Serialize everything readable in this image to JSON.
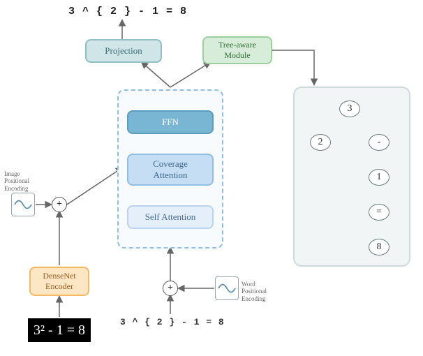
{
  "output_sequence": "3 ^ { 2 } - 1 = 8",
  "input_sequence": "3 ^ { 2 } - 1 = 8",
  "handwritten_input_display": "3² - 1 = 8",
  "blocks": {
    "densenet": "DenseNet\nEncoder",
    "projection": "Projection",
    "treeaware": "Tree-aware\nModule",
    "self_attention": "Self Attention",
    "coverage_attention": "Coverage\nAttention",
    "ffn": "FFN"
  },
  "captions": {
    "image_positional_encoding": "Image\nPositional\nEncoding",
    "word_positional_encoding": "Word\nPositional\nEncoding"
  },
  "tree": {
    "root": "3",
    "left": "2",
    "right": "-",
    "r_down1": "1",
    "r_down2": "=",
    "r_down3": "8"
  },
  "colors": {
    "densenet_bg": "#fde6c4",
    "projection_bg": "#cfe5e8",
    "treeaware_bg": "#d8edd9",
    "ffn_bg": "#79b6d3"
  }
}
